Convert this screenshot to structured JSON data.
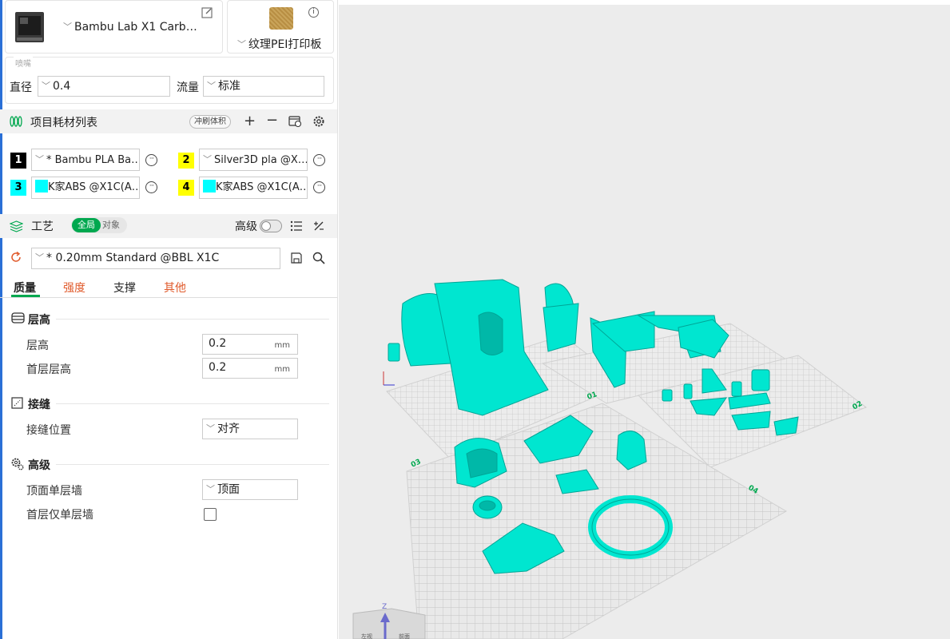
{
  "printer": {
    "name": "Bambu Lab X1 Carb…"
  },
  "plate_type": {
    "name": "纹理PEI打印板"
  },
  "nozzle": {
    "legend": "喷嘴",
    "diameter_label": "直径",
    "diameter_value": "0.4",
    "flow_label": "流量",
    "flow_value": "标准"
  },
  "filament_section": {
    "title": "项目耗材列表",
    "flush_button": "冲刷体积",
    "items": [
      {
        "num": "1",
        "name": "* Bambu PLA Ba…",
        "num_bg": "#000000",
        "num_fg": "#ffffff",
        "swatch": ""
      },
      {
        "num": "2",
        "name": "Silver3D pla @X…",
        "num_bg": "#ffff00",
        "num_fg": "#000000",
        "swatch": ""
      },
      {
        "num": "3",
        "name": "K家ABS @X1C(A…",
        "num_bg": "#00ffff",
        "num_fg": "#000000",
        "swatch": "#00ffff"
      },
      {
        "num": "4",
        "name": "K家ABS @X1C(A…",
        "num_bg": "#ffff00",
        "num_fg": "#000000",
        "swatch": "#00ffff"
      }
    ]
  },
  "process": {
    "title": "工艺",
    "toggle_global": "全局",
    "toggle_object": "对象",
    "advanced_label": "高级",
    "preset": "* 0.20mm Standard @BBL X1C",
    "tabs": [
      "质量",
      "强度",
      "支撑",
      "其他"
    ]
  },
  "groups": {
    "layer_height": {
      "title": "层高",
      "layer_height_label": "层高",
      "layer_height_value": "0.2",
      "first_layer_label": "首层层高",
      "first_layer_value": "0.2",
      "unit": "mm"
    },
    "seam": {
      "title": "接缝",
      "position_label": "接缝位置",
      "position_value": "对齐"
    },
    "advanced": {
      "title": "高级",
      "top_single_wall_label": "顶面单层墙",
      "top_single_wall_value": "顶面",
      "first_layer_single_wall_label": "首层仅单层墙"
    }
  },
  "viewport": {
    "plate_numbers": [
      "01",
      "02",
      "03",
      "04"
    ],
    "axis_z": "Z",
    "cube_left": "左视",
    "cube_right": "前面"
  },
  "colors": {
    "accent": "#00a84f",
    "model": "#00e6d0",
    "model_shadow": "#00b5a6",
    "link": "#e05a2b"
  }
}
